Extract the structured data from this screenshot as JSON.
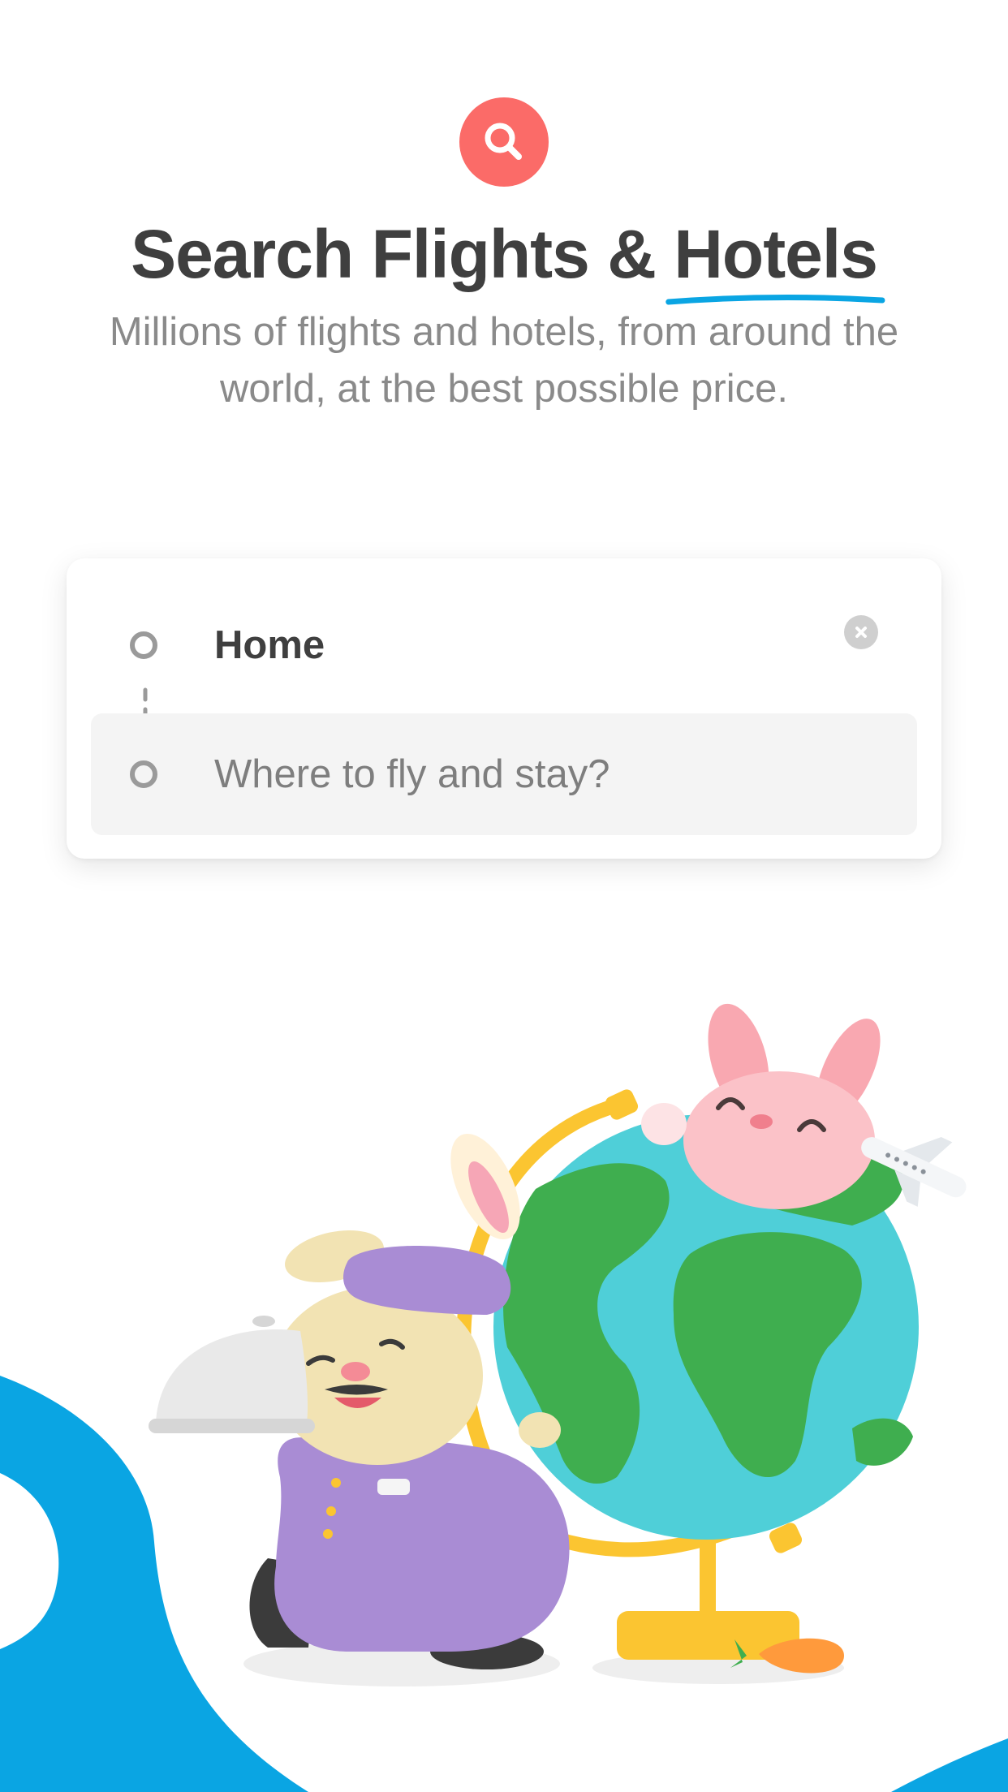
{
  "header": {
    "icon": "search-icon",
    "title_main": "Search Flights & ",
    "title_accent": "Hotels",
    "subtitle": "Millions of flights and hotels, from around the world, at the best possible price."
  },
  "search_form": {
    "origin_value": "Home",
    "origin_icon": "origin-dot-icon",
    "clear_icon": "clear-icon",
    "destination_placeholder": "Where to fly and stay?",
    "destination_icon": "destination-dot-icon"
  },
  "illustration": {
    "characters": [
      "bellhop-bunny",
      "pink-bunny",
      "globe",
      "airplane",
      "carrot",
      "serving-cloche"
    ]
  },
  "colors": {
    "accent_red": "#fb6b68",
    "accent_blue": "#0aa5e3",
    "text_dark": "#3f3f3f",
    "text_muted": "#8a8a8a",
    "field_bg": "#f4f4f4"
  }
}
